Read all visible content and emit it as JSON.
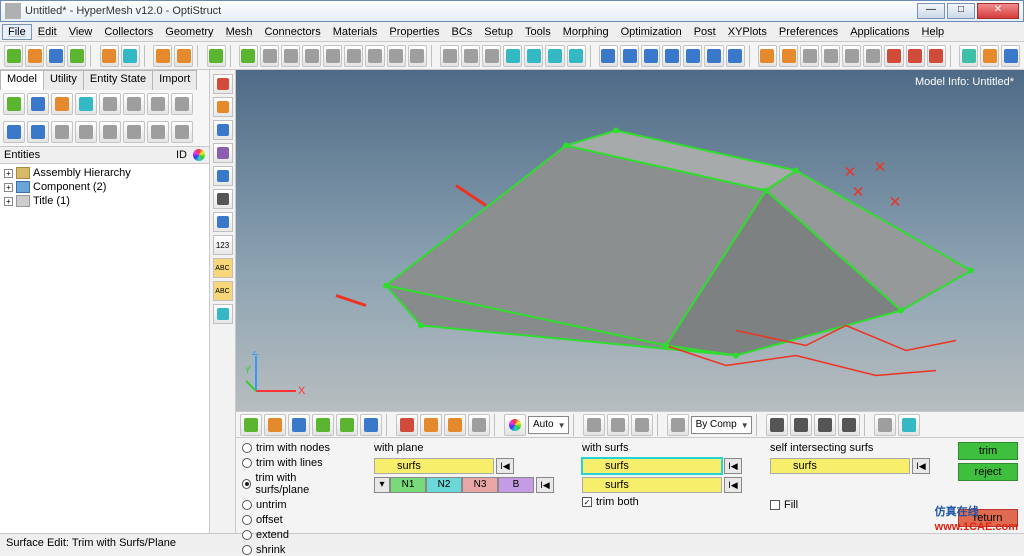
{
  "window": {
    "title": "Untitled* - HyperMesh v12.0 - OptiStruct"
  },
  "menu": [
    "File",
    "Edit",
    "View",
    "Collectors",
    "Geometry",
    "Mesh",
    "Connectors",
    "Materials",
    "Properties",
    "BCs",
    "Setup",
    "Tools",
    "Morphing",
    "Optimization",
    "Post",
    "XYPlots",
    "Preferences",
    "Applications",
    "Help"
  ],
  "left_tabs": [
    "Model",
    "Utility",
    "Entity State",
    "Import"
  ],
  "entities_header": {
    "col1": "Entities",
    "col2": "ID"
  },
  "tree": [
    {
      "label": "Assembly Hierarchy",
      "icon": "folder"
    },
    {
      "label": "Component (2)",
      "icon": "comp"
    },
    {
      "label": "Title (1)",
      "icon": "title"
    }
  ],
  "viewport": {
    "model_info": "Model Info: Untitled*",
    "watermark": "1CAE.COM",
    "axes": [
      "X",
      "Y",
      "Z"
    ]
  },
  "combo_auto": "Auto",
  "combo_bycomp": "By Comp",
  "options": {
    "radios": [
      "trim with nodes",
      "trim with lines",
      "trim with surfs/plane",
      "untrim",
      "offset",
      "extend",
      "shrink"
    ],
    "selected_radio": 2,
    "with_plane": {
      "label": "with plane",
      "field": "surfs",
      "cells": [
        "N1",
        "N2",
        "N3",
        "B"
      ]
    },
    "with_surfs": {
      "label": "with surfs",
      "field1": "surfs",
      "field2": "surfs",
      "check": "trim both",
      "checked": true
    },
    "self": {
      "label": "self intersecting surfs",
      "field": "surfs"
    },
    "fill_label": "Fill",
    "buttons": {
      "trim": "trim",
      "reject": "reject",
      "return": "return"
    }
  },
  "status": "Surface Edit: Trim with Surfs/Plane",
  "footer": {
    "cn": "仿真在线",
    "url": "www.1CAE.com"
  }
}
